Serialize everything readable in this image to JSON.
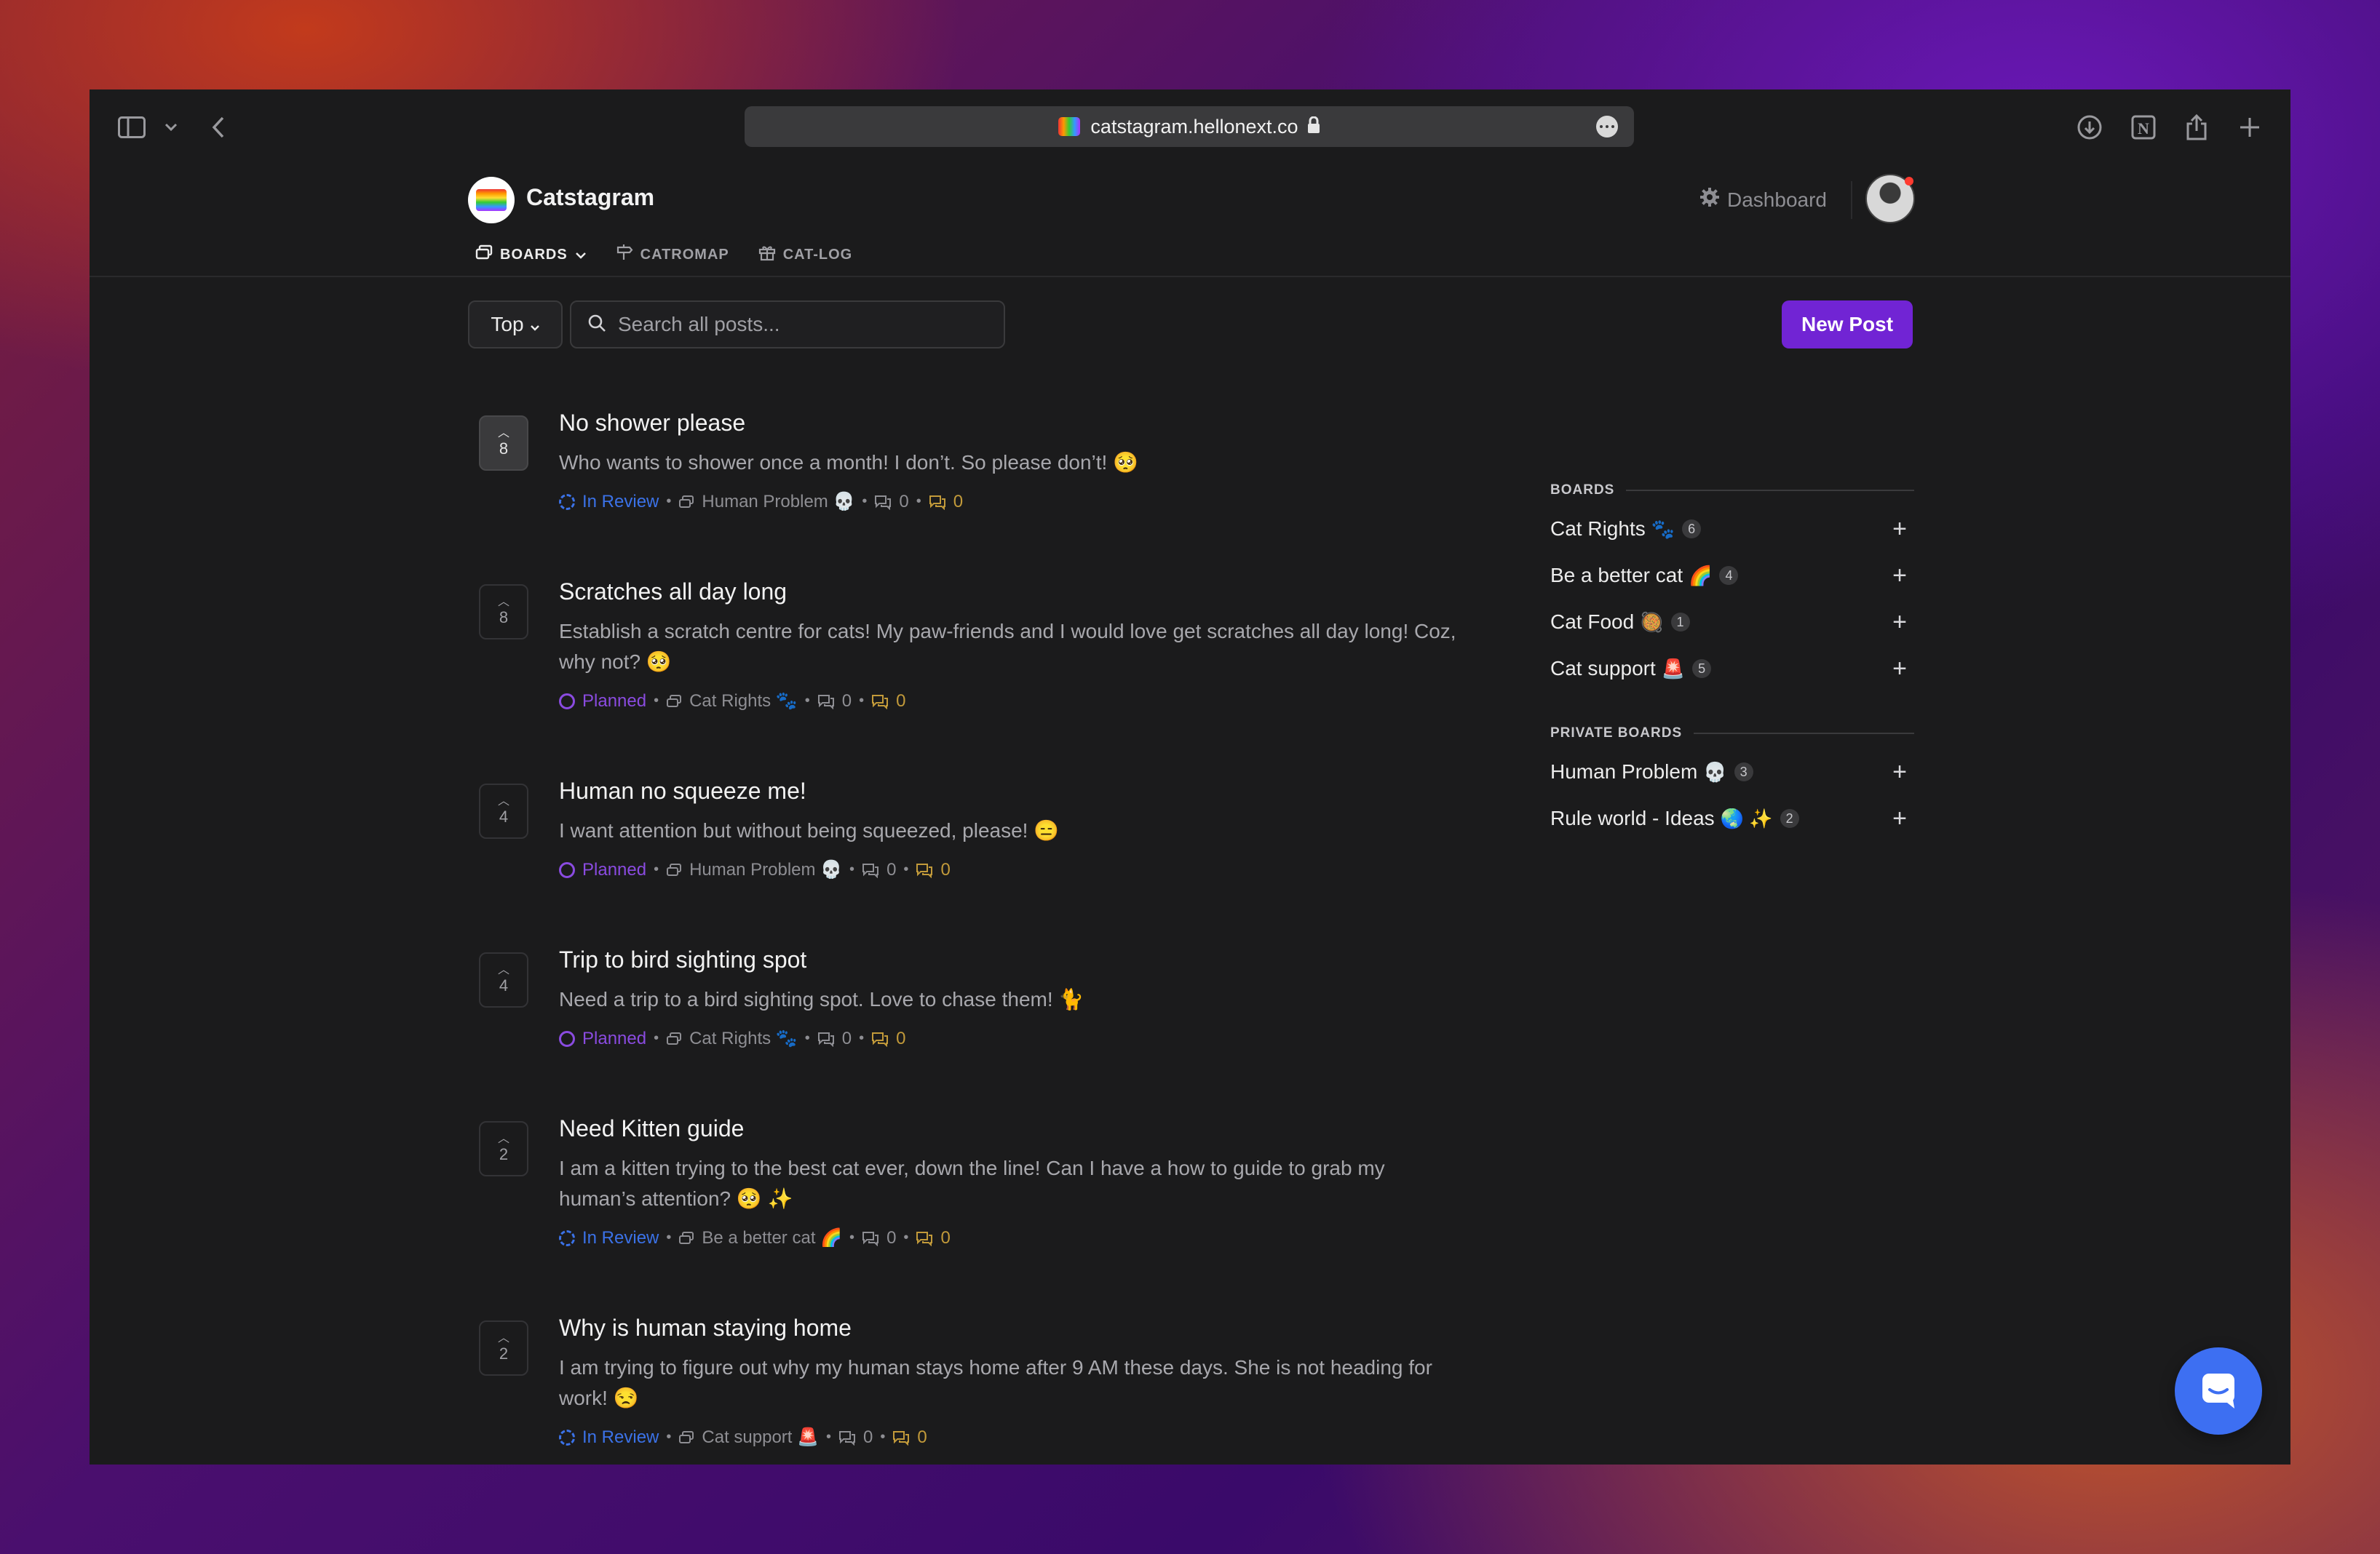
{
  "browser": {
    "url": "catstagram.hellonext.co",
    "icons": [
      "sidebar-toggle-icon",
      "chevron-down-icon",
      "back-arrow-icon",
      "lock-icon",
      "more-icon",
      "download-icon",
      "notion-icon",
      "share-icon",
      "new-tab-icon"
    ]
  },
  "header": {
    "brand": "Catstagram",
    "dashboard_label": "Dashboard",
    "nav": [
      {
        "label": "BOARDS",
        "active": true,
        "has_dropdown": true,
        "icon": "boards-icon"
      },
      {
        "label": "CATROMAP",
        "active": false,
        "icon": "signpost-icon"
      },
      {
        "label": "CAT-LOG",
        "active": false,
        "icon": "gift-icon"
      }
    ]
  },
  "toolbar": {
    "sort_label": "Top",
    "search_placeholder": "Search all posts...",
    "new_post_label": "New Post"
  },
  "posts": [
    {
      "votes": "8",
      "voted": true,
      "title": "No shower please",
      "body": "Who wants to shower once a month! I don’t. So please don’t! 🥺",
      "status": "In Review",
      "status_kind": "review",
      "board": "Human Problem 💀",
      "comments": "0",
      "replies": "0"
    },
    {
      "votes": "8",
      "voted": false,
      "title": "Scratches all day long",
      "body": "Establish a scratch centre for cats! My paw-friends and I would love get scratches all day long! Coz, why not? 🥺",
      "status": "Planned",
      "status_kind": "planned",
      "board": "Cat Rights 🐾",
      "comments": "0",
      "replies": "0"
    },
    {
      "votes": "4",
      "voted": false,
      "title": "Human no squeeze me!",
      "body": "I want attention but without being squeezed, please! 😑",
      "status": "Planned",
      "status_kind": "planned",
      "board": "Human Problem 💀",
      "comments": "0",
      "replies": "0"
    },
    {
      "votes": "4",
      "voted": false,
      "title": "Trip to bird sighting spot",
      "body": "Need a trip to a bird sighting spot. Love to chase them! 🐈",
      "status": "Planned",
      "status_kind": "planned",
      "board": "Cat Rights 🐾",
      "comments": "0",
      "replies": "0"
    },
    {
      "votes": "2",
      "voted": false,
      "title": "Need Kitten guide",
      "body": "I am a kitten trying to the best cat ever, down the line! Can I have a how to guide to grab my human’s attention? 🥺 ✨",
      "status": "In Review",
      "status_kind": "review",
      "board": "Be a better cat 🌈",
      "comments": "0",
      "replies": "0"
    },
    {
      "votes": "2",
      "voted": false,
      "title": "Why is human staying home",
      "body": "I am trying to figure out why my human stays home after 9 AM these days. She is not heading for work! 😒",
      "status": "In Review",
      "status_kind": "review",
      "board": "Cat support 🚨",
      "comments": "0",
      "replies": "0"
    }
  ],
  "sidebar": {
    "boards_heading": "BOARDS",
    "boards": [
      {
        "name": "Cat Rights",
        "emoji": "🐾",
        "count": "6"
      },
      {
        "name": "Be a better cat",
        "emoji": "🌈",
        "count": "4"
      },
      {
        "name": "Cat Food",
        "emoji": "🥘",
        "count": "1"
      },
      {
        "name": "Cat support",
        "emoji": "🚨",
        "count": "5"
      }
    ],
    "private_heading": "PRIVATE BOARDS",
    "private_boards": [
      {
        "name": "Human Problem",
        "emoji": "💀",
        "count": "3"
      },
      {
        "name": "Rule world - Ideas",
        "emoji": "🌏 ✨",
        "count": "2"
      }
    ],
    "plus_label": "+"
  },
  "colors": {
    "accent": "#7124d4",
    "status_review": "#3b72e8",
    "status_planned": "#8a4be0",
    "chat": "#3d6ff2"
  }
}
